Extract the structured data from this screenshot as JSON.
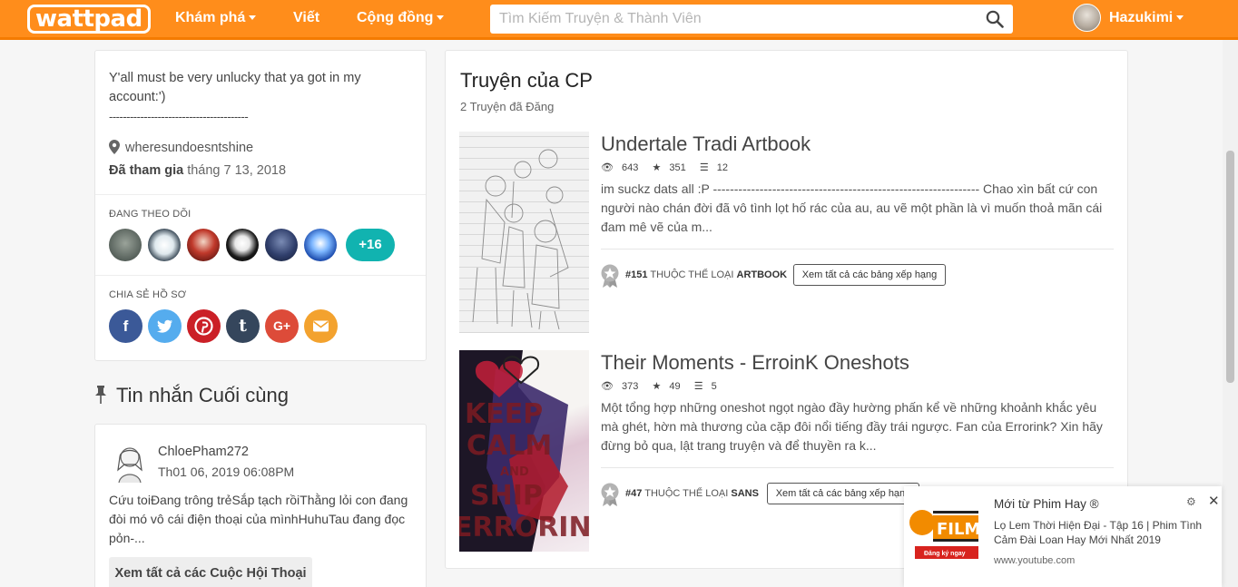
{
  "nav": {
    "logo": "wattpad",
    "discover": "Khám phá",
    "write": "Viết",
    "community": "Cộng đồng",
    "search_placeholder": "Tìm Kiếm Truyện & Thành Viên",
    "username": "Hazukimi"
  },
  "about": {
    "text": "Y'all must be very unlucky that ya got in my account:')",
    "dashes": "----------------------------------------",
    "location": "wheresundoesntshine",
    "joined_label": "Đã tham gia",
    "joined_date": "tháng 7 13, 2018",
    "following_label": "ĐANG THEO DÕI",
    "following_more": "+16",
    "share_label": "CHIA SẺ HỒ SƠ",
    "share_icons": [
      "f",
      "t",
      "p",
      "t",
      "G+",
      "✉"
    ]
  },
  "pinned": {
    "title": "Tin nhắn Cuối cùng",
    "user": "ChloePham272",
    "date": "Th01 06, 2019 06:08PM",
    "body": "Cứu toiĐang trông trẻSắp tạch rồiThằng lỏi con đang đòi mó vô cái điện thoại của mìnhHuhuTau đang đọc pỏn-...",
    "button": "Xem tất cả các Cuộc Hội Thoại"
  },
  "stories": {
    "title": "Truyện của CP",
    "count": "2 Truyện đã Đăng",
    "items": [
      {
        "title": "Undertale Tradi Artbook",
        "reads": "643",
        "votes": "351",
        "parts": "12",
        "description": "im suckz dats all :P --------------------------------------------------------------- Chao xìn bất cứ con người nào chán đời đã vô tình lọt hố rác của au, au vẽ một phần là vì muốn thoả mãn cái đam mê vẽ của m...",
        "rank_num": "#151",
        "rank_text": "THUỘC THỂ LOẠI",
        "rank_cat": "ARTBOOK",
        "rank_button": "Xem tất cả các bảng xếp hạng"
      },
      {
        "title": "Their Moments - ErroinK Oneshots",
        "reads": "373",
        "votes": "49",
        "parts": "5",
        "description": "Một tổng hợp những oneshot ngọt ngào đầy hường phấn kể về những khoảnh khắc yêu mà ghét, hờn mà thương của cặp đôi nổi tiếng đầy trái ngược. Fan của Errorink? Xin hãy đừng bỏ qua, lật trang truyện và để thuyền ra k...",
        "rank_num": "#47",
        "rank_text": "THUỘC THỂ LOẠI",
        "rank_cat": "SANS",
        "rank_button": "Xem tất cả các bảng xếp hạng",
        "cover_text": [
          "KEEP",
          "CALM",
          "AND",
          "SHIP",
          "ERRORINK"
        ]
      }
    ]
  },
  "popup": {
    "heading": "Mới từ Phim Hay ®",
    "body": "Lọ Lem Thời Hiện Đại - Tập 16 | Phim Tình Cảm Đài Loan Hay Mới Nhất 2019",
    "url": "www.youtube.com",
    "logo_text": "FILM",
    "logo_sub": "Đăng ký ngay"
  },
  "colors": {
    "brand": "#ff8d1b",
    "teal": "#11b3b0",
    "facebook": "#3b5998",
    "twitter": "#55acee",
    "pinterest": "#cb2027",
    "tumblr": "#35465c",
    "googleplus": "#dd4b39",
    "email": "#f3a22e"
  }
}
